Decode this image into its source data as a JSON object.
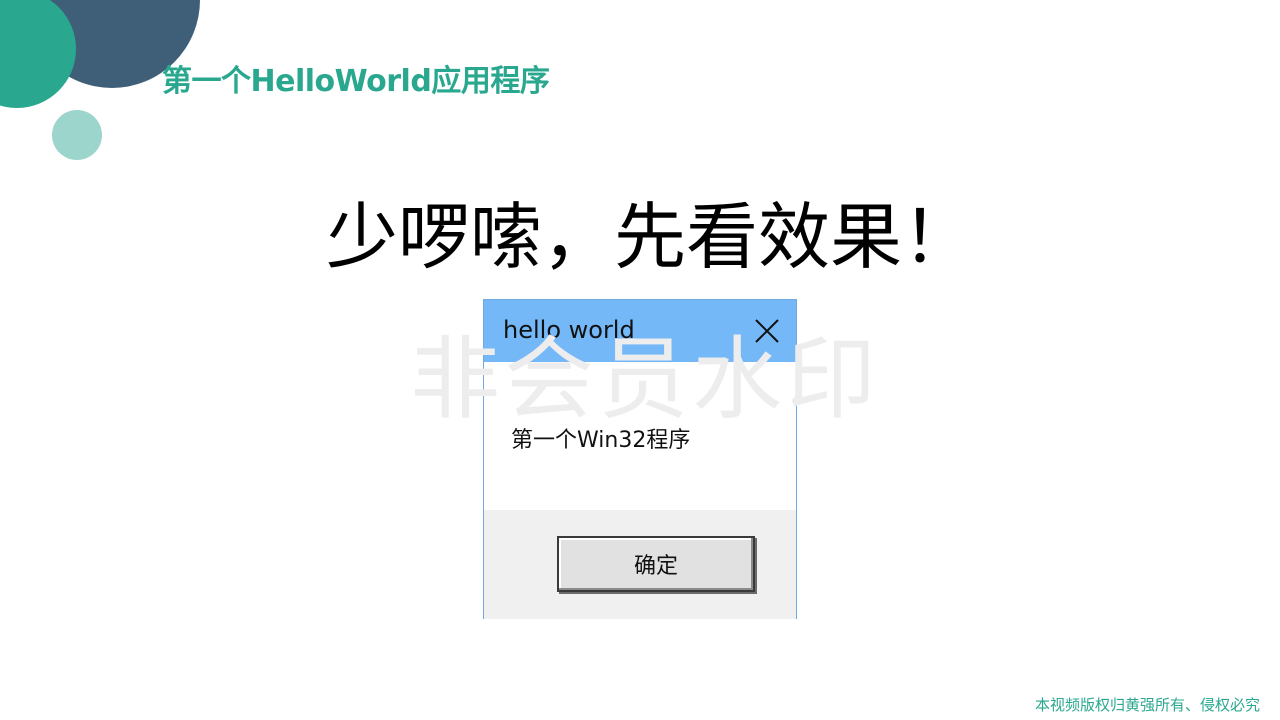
{
  "slide": {
    "title": "第一个HelloWorld应用程序",
    "headline": "少啰嗦，先看效果！",
    "watermark": "非会员水印",
    "copyright": "本视频版权归黄强所有、侵权必究"
  },
  "message_box": {
    "title": "hello world",
    "message": "第一个Win32程序",
    "ok_label": "确定",
    "close_icon": "close-icon",
    "titlebar_color": "#74b8f8"
  },
  "colors": {
    "accent": "#2aa88f",
    "navy": "#3f5f78",
    "light_teal": "#9bd5cb"
  }
}
